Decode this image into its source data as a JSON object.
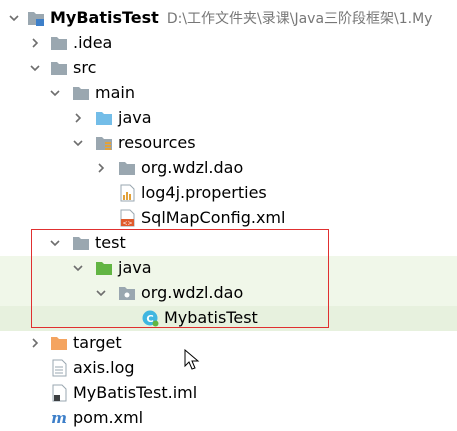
{
  "tree": {
    "root": {
      "label": "MyBatisTest",
      "path": "D:\\工作文件夹\\录课\\Java三阶段框架\\1.My"
    },
    "items": [
      {
        "label": ".idea"
      },
      {
        "label": "src"
      },
      {
        "label": "main"
      },
      {
        "label": "java"
      },
      {
        "label": "resources"
      },
      {
        "label": "org.wdzl.dao"
      },
      {
        "label": "log4j.properties"
      },
      {
        "label": "SqlMapConfig.xml"
      },
      {
        "label": "test"
      },
      {
        "label": "java"
      },
      {
        "label": "org.wdzl.dao"
      },
      {
        "label": "MybatisTest"
      },
      {
        "label": "target"
      },
      {
        "label": "axis.log"
      },
      {
        "label": "MyBatisTest.iml"
      },
      {
        "label": "pom.xml"
      }
    ]
  },
  "icons": {
    "root": "module-folder-icon",
    "folder": "folder-icon",
    "source_root": "source-folder-icon",
    "resources_root": "resources-folder-icon",
    "test_root": "test-source-folder-icon",
    "package": "package-icon",
    "excluded": "excluded-folder-icon",
    "properties": "properties-file-icon",
    "xml": "xml-file-icon",
    "class": "java-class-icon",
    "log": "log-file-icon",
    "iml": "iml-file-icon",
    "maven": "maven-pom-icon"
  },
  "colors": {
    "folder": "#9aa7b0",
    "source_root": "#73bde8",
    "test_root": "#62b543",
    "excluded": "#f4a460",
    "highlight": "#f0f7e9",
    "selection_box": "#e03030",
    "class_icon": "#40b6e0"
  }
}
